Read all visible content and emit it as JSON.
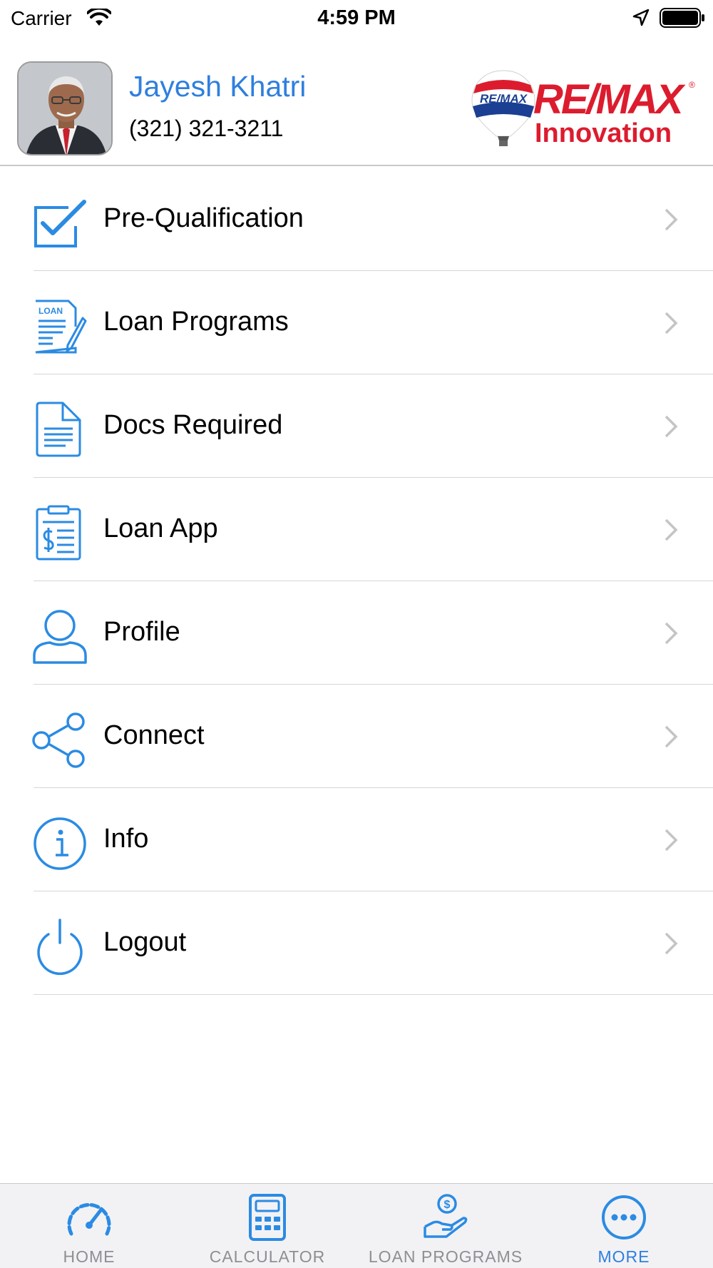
{
  "status_bar": {
    "carrier": "Carrier",
    "time": "4:59 PM",
    "icons": [
      "wifi-icon",
      "location-icon",
      "battery-icon"
    ]
  },
  "header": {
    "agent_name": "Jayesh Khatri",
    "agent_phone": "(321) 321-3211",
    "logo": {
      "brand": "RE/MAX",
      "sub": "Innovation",
      "balloon_text": "RE/MAX",
      "registered_mark": "®"
    }
  },
  "menu": {
    "items": [
      {
        "label": "Pre-Qualification",
        "icon": "checkbox-icon"
      },
      {
        "label": "Loan Programs",
        "icon": "loan-document-icon",
        "icon_text": "LOAN"
      },
      {
        "label": "Docs Required",
        "icon": "document-icon"
      },
      {
        "label": "Loan App",
        "icon": "clipboard-dollar-icon"
      },
      {
        "label": "Profile",
        "icon": "user-icon"
      },
      {
        "label": "Connect",
        "icon": "share-icon"
      },
      {
        "label": "Info",
        "icon": "info-icon"
      },
      {
        "label": "Logout",
        "icon": "power-icon"
      }
    ]
  },
  "tab_bar": {
    "tabs": [
      {
        "label": "HOME",
        "icon": "speedometer-icon",
        "active": false
      },
      {
        "label": "CALCULATOR",
        "icon": "calculator-icon",
        "active": false
      },
      {
        "label": "LOAN PROGRAMS",
        "icon": "hand-dollar-icon",
        "active": false
      },
      {
        "label": "MORE",
        "icon": "more-icon",
        "active": true
      }
    ]
  },
  "colors": {
    "accent": "#2f7fde",
    "icon_blue": "#2b8be3",
    "brand_red": "#dc1c2e",
    "brand_blue": "#1a3f93",
    "separator": "#d6d6da",
    "tab_inactive": "#8e8e93",
    "tab_bar_bg": "#f2f2f5"
  }
}
